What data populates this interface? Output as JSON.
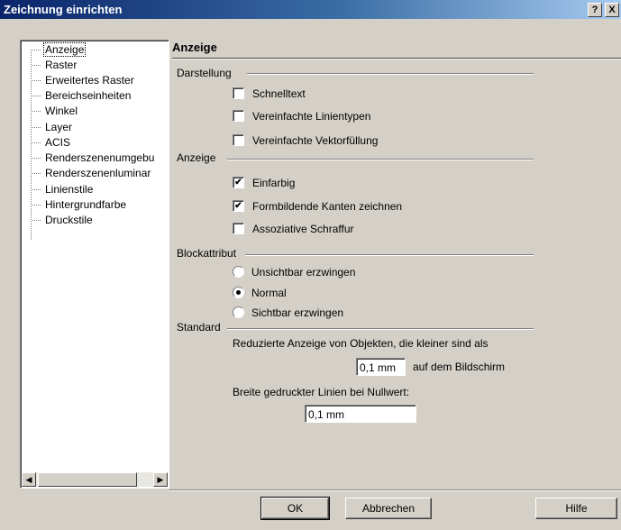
{
  "window": {
    "title": "Zeichnung einrichten",
    "help_btn": "?",
    "close_btn": "X"
  },
  "tree": {
    "items": [
      {
        "label": "Anzeige",
        "selected": true
      },
      {
        "label": "Raster"
      },
      {
        "label": "Erweitertes Raster"
      },
      {
        "label": "Bereichseinheiten"
      },
      {
        "label": "Winkel"
      },
      {
        "label": "Layer"
      },
      {
        "label": "ACIS"
      },
      {
        "label": "Renderszenenumgebu"
      },
      {
        "label": "Renderszenenluminar"
      },
      {
        "label": "Linienstile"
      },
      {
        "label": "Hintergrundfarbe"
      },
      {
        "label": "Druckstile"
      }
    ],
    "scroll_left": "◀",
    "scroll_right": "▶"
  },
  "panel": {
    "title": "Anzeige",
    "darstellung": {
      "label": "Darstellung",
      "options": [
        {
          "label": "Schnelltext",
          "checked": false
        },
        {
          "label": "Vereinfachte Linientypen",
          "checked": false
        },
        {
          "label": "Vereinfachte Vektorfüllung",
          "checked": false
        }
      ]
    },
    "anzeige": {
      "label": "Anzeige",
      "options": [
        {
          "label": "Einfarbig",
          "checked": true
        },
        {
          "label": "Formbildende Kanten zeichnen",
          "checked": true
        },
        {
          "label": "Assoziative Schraffur",
          "checked": false
        }
      ]
    },
    "blockattribut": {
      "label": "Blockattribut",
      "options": [
        {
          "label": "Unsichtbar erzwingen",
          "selected": false
        },
        {
          "label": "Normal",
          "selected": true
        },
        {
          "label": "Sichtbar erzwingen",
          "selected": false
        }
      ]
    },
    "standard": {
      "label": "Standard",
      "reduce_text": "Reduzierte Anzeige von Objekten, die kleiner sind als",
      "reduce_value": "0,1 mm",
      "reduce_suffix": "auf dem Bildschirm",
      "line_width_text": "Breite gedruckter Linien bei Nullwert:",
      "line_width_value": "0,1 mm"
    }
  },
  "buttons": {
    "ok": "OK",
    "cancel": "Abbrechen",
    "help": "Hilfe"
  },
  "check_mark": "✔"
}
